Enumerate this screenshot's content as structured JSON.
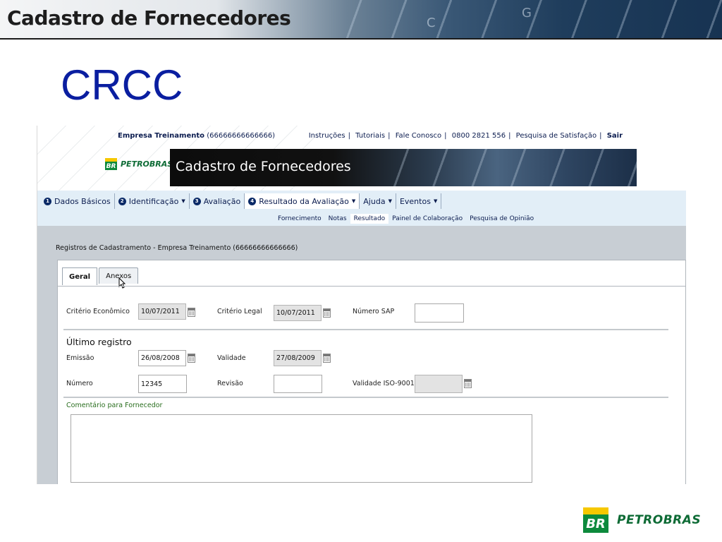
{
  "slide": {
    "banner_title": "Cadastro de Fornecedores",
    "title": "CRCC",
    "footer_logo_text": "PETROBRAS",
    "footer_logo_mark": "BR"
  },
  "header": {
    "company_name": "Empresa Treinamento",
    "company_id": "(66666666666666)",
    "links": [
      {
        "label": "Instruções"
      },
      {
        "label": "Tutoriais"
      },
      {
        "label": "Fale Conosco"
      },
      {
        "label": "0800 2821 556"
      },
      {
        "label": "Pesquisa de Satisfação"
      },
      {
        "label": "Sair"
      }
    ],
    "logo_mark": "BR",
    "logo_text": "PETROBRAS",
    "app_title": "Cadastro de Fornecedores"
  },
  "menu": {
    "items": [
      {
        "num": "1",
        "label": "Dados Básicos"
      },
      {
        "num": "2",
        "label": "Identificação",
        "caret": "▼"
      },
      {
        "num": "3",
        "label": "Avaliação"
      },
      {
        "num": "4",
        "label": "Resultado da Avaliação",
        "caret": "▼"
      },
      {
        "label": "Ajuda",
        "caret": "▼"
      },
      {
        "label": "Eventos",
        "caret": "▼"
      }
    ],
    "submenu": [
      "Fornecimento",
      "Notas",
      "Resultado",
      "Painel de Colaboração",
      "Pesquisa de Opinião"
    ]
  },
  "panel": {
    "header": "Registros de Cadastramento - Empresa Treinamento (66666666666666)",
    "tabs": [
      "Geral",
      "Anexos"
    ]
  },
  "form": {
    "criterio_economico_label": "Critério Econômico",
    "criterio_economico_value": "10/07/2011",
    "criterio_legal_label": "Critério Legal",
    "criterio_legal_value": "10/07/2011",
    "numero_sap_label": "Número SAP",
    "numero_sap_value": "",
    "ultimo_registro_title": "Último registro",
    "emissao_label": "Emissão",
    "emissao_value": "26/08/2008",
    "validade_label": "Validade",
    "validade_value": "27/08/2009",
    "numero_label": "Número",
    "numero_value": "12345",
    "revisao_label": "Revisão",
    "revisao_value": "",
    "validade_iso_label": "Validade ISO-9001",
    "validade_iso_value": "",
    "comentario_label": "Comentário para Fornecedor",
    "comentario_value": ""
  },
  "colors": {
    "slide_title": "#0a1ea0",
    "menu_bg": "#e2eef7",
    "petrobras_green": "#0d8a3c",
    "petrobras_yellow": "#f6c800",
    "comment_label": "#2a6e1f"
  }
}
